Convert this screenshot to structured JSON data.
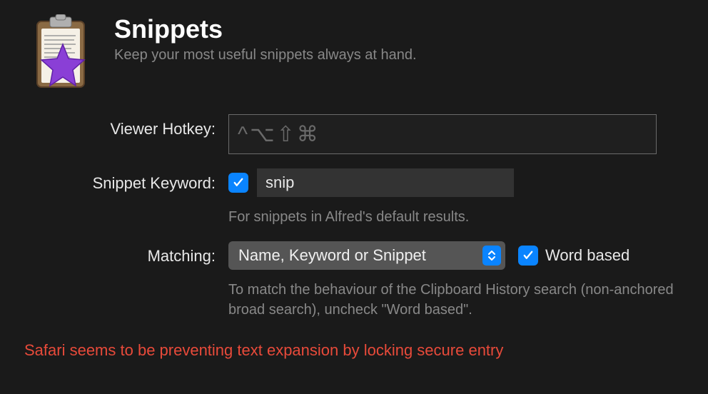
{
  "header": {
    "title": "Snippets",
    "subtitle": "Keep your most useful snippets always at hand."
  },
  "viewer_hotkey": {
    "label": "Viewer Hotkey:",
    "symbols": "^⌥⇧⌘"
  },
  "snippet_keyword": {
    "label": "Snippet Keyword:",
    "checked": true,
    "value": "snip",
    "help": "For snippets in Alfred's default results."
  },
  "matching": {
    "label": "Matching:",
    "selected": "Name, Keyword or Snippet",
    "word_based_label": "Word based",
    "word_based_checked": true,
    "help": "To match the behaviour of the Clipboard History search (non-anchored broad search), uncheck \"Word based\"."
  },
  "warning": "Safari seems to be preventing text expansion by locking secure entry"
}
